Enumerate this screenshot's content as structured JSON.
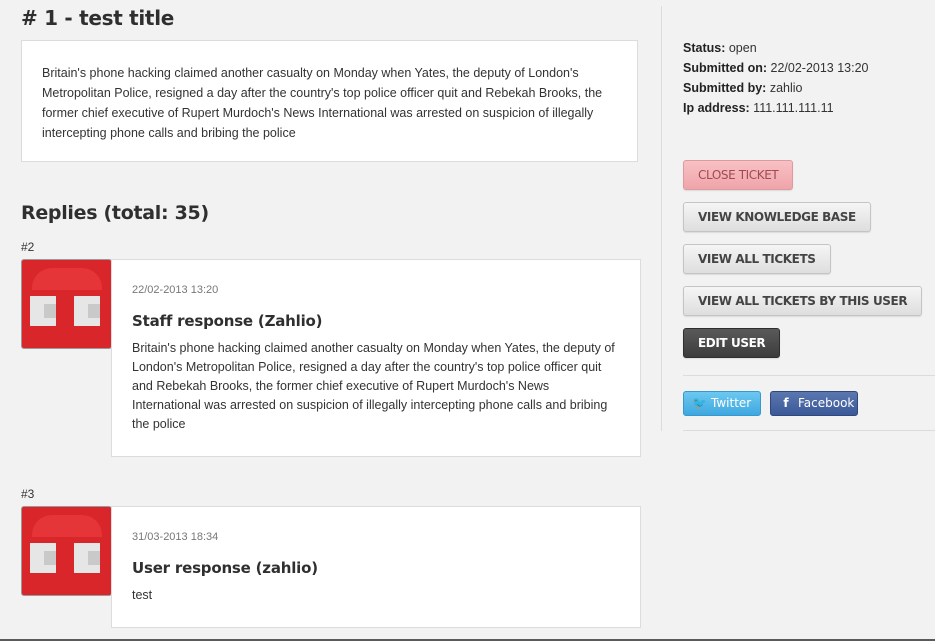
{
  "ticket": {
    "title": "# 1 - test title",
    "body": "Britain's phone hacking claimed another casualty on Monday when Yates, the deputy of London's Metropolitan Police, resigned a day after the country's top police officer quit and Rebekah Brooks, the former chief executive of Rupert Murdoch's News International was arrested on suspicion of illegally intercepting phone calls and bribing the police"
  },
  "replies": {
    "heading": "Replies (total: 35)",
    "items": [
      {
        "number": "#2",
        "date": "22/02-2013 13:20",
        "author": "Staff response (Zahlio)",
        "text": "Britain's phone hacking claimed another casualty on Monday when Yates, the deputy of London's Metropolitan Police, resigned a day after the country's top police officer quit and Rebekah Brooks, the former chief executive of Rupert Murdoch's News International was arrested on suspicion of illegally intercepting phone calls and bribing the police"
      },
      {
        "number": "#3",
        "date": "31/03-2013 18:34",
        "author": "User response (zahlio)",
        "text": "test"
      }
    ]
  },
  "sidebar": {
    "meta": [
      {
        "label": "Status:",
        "value": "open"
      },
      {
        "label": "Submitted on:",
        "value": "22/02-2013 13:20"
      },
      {
        "label": "Submitted by:",
        "value": "zahlio"
      },
      {
        "label": "Ip address:",
        "value": "111.111.111.11"
      }
    ],
    "buttons": {
      "close": "CLOSE TICKET",
      "knowledge_base": "VIEW KNOWLEDGE BASE",
      "all_tickets": "VIEW ALL TICKETS",
      "tickets_by_user": "VIEW ALL TICKETS BY THIS USER",
      "edit_user": "EDIT USER"
    },
    "social": {
      "twitter": "Twitter",
      "facebook": "Facebook",
      "twitter_icon": "twitter-bird-icon",
      "facebook_icon": "facebook-f-icon"
    }
  },
  "colors": {
    "close_button": "#efa5aa",
    "edit_button": "#3c3c3c",
    "twitter": "#3fa8e0",
    "facebook": "#3b5998",
    "avatar": "#d9262a"
  }
}
